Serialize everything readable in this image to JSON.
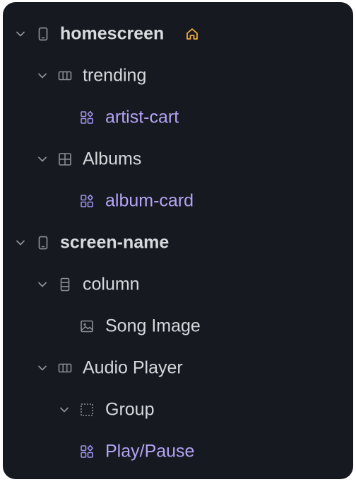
{
  "tree": {
    "rows": [
      {
        "label": "homescreen",
        "kind": "screen",
        "icon": "phone-icon",
        "expanded": true,
        "badge": "home-icon"
      },
      {
        "label": "trending",
        "kind": "container",
        "icon": "row-layout-icon",
        "expanded": true
      },
      {
        "label": "artist-cart",
        "kind": "component",
        "icon": "component-icon"
      },
      {
        "label": "Albums",
        "kind": "container",
        "icon": "grid-layout-icon",
        "expanded": true
      },
      {
        "label": "album-card",
        "kind": "component",
        "icon": "component-icon"
      },
      {
        "label": "screen-name",
        "kind": "screen",
        "icon": "phone-icon",
        "expanded": true
      },
      {
        "label": "column",
        "kind": "container",
        "icon": "column-layout-icon",
        "expanded": true
      },
      {
        "label": "Song Image",
        "kind": "element",
        "icon": "image-icon"
      },
      {
        "label": "Audio Player",
        "kind": "container",
        "icon": "row-layout-icon",
        "expanded": true
      },
      {
        "label": "Group",
        "kind": "container",
        "icon": "group-dashed-icon",
        "expanded": true
      },
      {
        "label": "Play/Pause",
        "kind": "component",
        "icon": "component-icon"
      }
    ]
  },
  "colors": {
    "panel_bg": "#161a20",
    "text": "#d6d8dc",
    "component_text": "#b4a3f5",
    "component_icon": "#9f90e8",
    "home_accent": "#f0a93a",
    "muted_icon": "#8b9098"
  }
}
